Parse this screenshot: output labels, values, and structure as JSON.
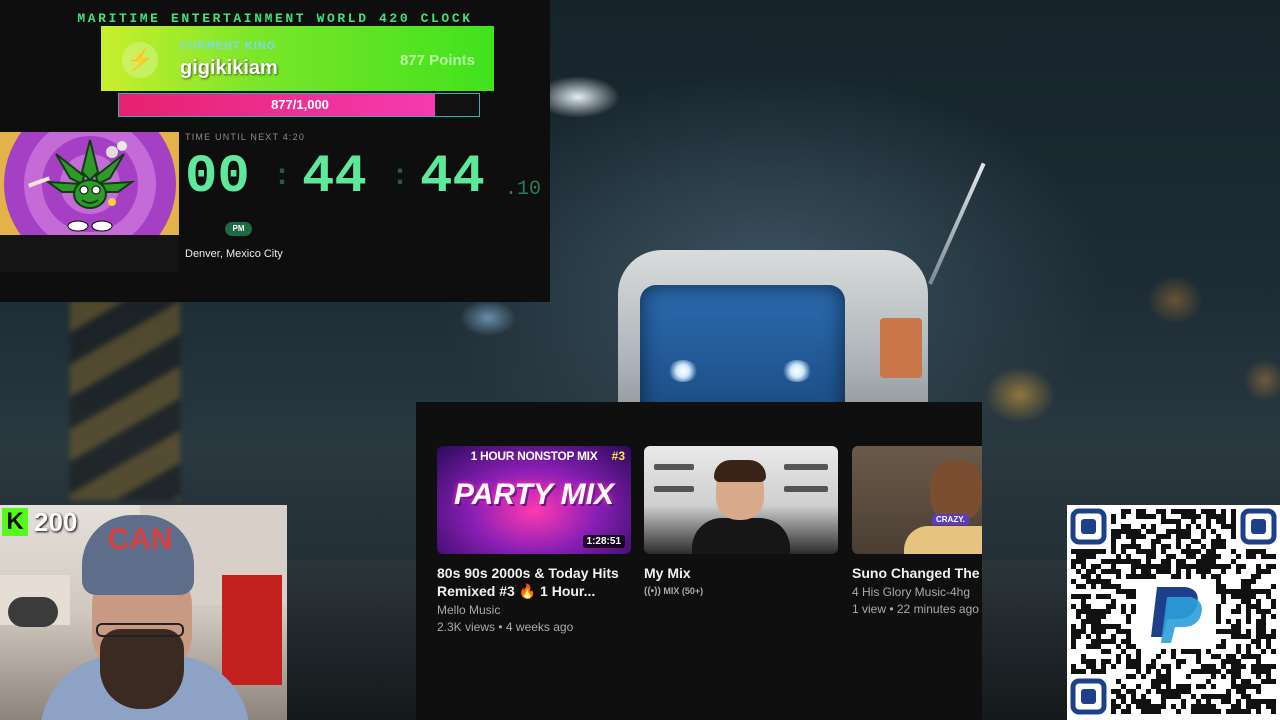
{
  "clock": {
    "title": "MARITIME ENTERTAINMENT WORLD 420 CLOCK",
    "king_label": "CURRENT KING",
    "king_name": "gigikikiam",
    "king_points": "877 Points",
    "progress_text": "877/1,000",
    "progress_value": 0.877,
    "countdown_label": "TIME UNTIL NEXT 4:20",
    "hours": "00",
    "minutes": "44",
    "seconds": "44",
    "tenths": ".10",
    "ampm": "PM",
    "cities": "Denver, Mexico City"
  },
  "youtube": {
    "videos": [
      {
        "thumb_top": "1 HOUR NONSTOP MIX",
        "thumb_num": "#3",
        "thumb_main": "PARTY MIX",
        "duration": "1:28:51",
        "title": "80s 90s 2000s & Today Hits\nRemixed #3 🔥 1 Hour...",
        "channel": "Mello Music",
        "stats": "2.3K views • 4 weeks ago"
      },
      {
        "title": "My Mix",
        "meta_icon": "((•))",
        "meta": "MIX (50+)"
      },
      {
        "thumb_badge": "CRAZY.",
        "title": "Suno Changed The G",
        "channel": "4 His Glory Music-4hg",
        "stats": "1 view • 22 minutes ago"
      }
    ]
  },
  "stream": {
    "kick_logo": "K",
    "viewer_count": "200",
    "hat_text": "CAN"
  },
  "colors": {
    "clock_green": "#5ee89a",
    "banner_green": "#41e21d",
    "progress_pink": "#e7216f",
    "kick_green": "#53fc18",
    "paypal_blue": "#1e3f8a"
  },
  "icons": {
    "bolt": "lightning-bolt-icon",
    "leaf": "cannabis-leaf-icon",
    "radio": "broadcast-icon",
    "paypal": "paypal-logo-icon"
  }
}
